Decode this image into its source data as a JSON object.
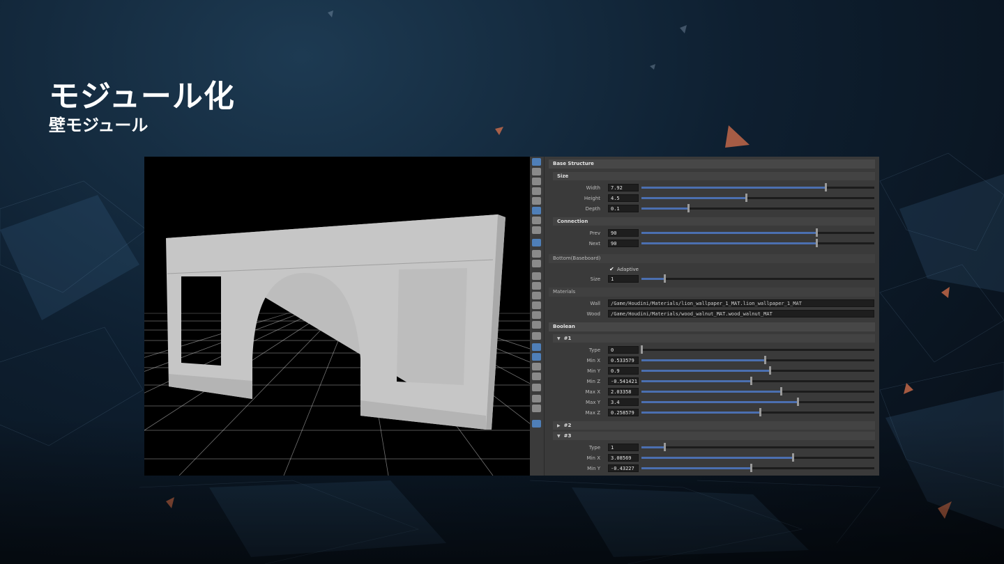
{
  "slide": {
    "title": "モジュール化",
    "subtitle": "壁モジュール"
  },
  "colors": {
    "slider_fill": "#4b6fb0",
    "panel_bg": "#3a3a3a",
    "field_bg": "#1e1e1e",
    "accent_triangle": "#e0744c"
  },
  "panel": {
    "base_structure": "Base Structure",
    "size": {
      "header": "Size",
      "width": {
        "label": "Width",
        "value": "7.92",
        "frac": 0.79
      },
      "height": {
        "label": "Height",
        "value": "4.5",
        "frac": 0.45
      },
      "depth": {
        "label": "Depth",
        "value": "0.1",
        "frac": 0.2
      }
    },
    "connection": {
      "header": "Connection",
      "prev": {
        "label": "Prev",
        "value": "90",
        "frac": 0.75
      },
      "next": {
        "label": "Next",
        "value": "90",
        "frac": 0.75
      }
    },
    "bottom": {
      "header": "Bottom(Baseboard)",
      "adaptive": {
        "label": "Adaptive",
        "checked": true
      },
      "size": {
        "label": "Size",
        "value": "1",
        "frac": 0.1
      }
    },
    "materials": {
      "header": "Materials",
      "wall": {
        "label": "Wall",
        "value": "/Game/Houdini/Materials/lion_wallpaper_1_MAT.lion_wallpaper_1_MAT"
      },
      "wood": {
        "label": "Wood",
        "value": "/Game/Houdini/Materials/wood_walnut_MAT.wood_walnut_MAT"
      }
    },
    "boolean": {
      "header": "Boolean",
      "b1": {
        "header": "#1",
        "type": {
          "label": "Type",
          "value": "0",
          "frac": 0.0
        },
        "minx": {
          "label": "Min X",
          "value": "0.533579",
          "frac": 0.53
        },
        "miny": {
          "label": "Min Y",
          "value": "0.9",
          "frac": 0.55
        },
        "minz": {
          "label": "Min Z",
          "value": "-0.541421",
          "frac": 0.47
        },
        "maxx": {
          "label": "Max X",
          "value": "2.03358",
          "frac": 0.6
        },
        "maxy": {
          "label": "Max Y",
          "value": "3.4",
          "frac": 0.67
        },
        "maxz": {
          "label": "Max Z",
          "value": "0.258579",
          "frac": 0.51
        }
      },
      "b2": {
        "header": "#2"
      },
      "b3": {
        "header": "#3",
        "type": {
          "label": "Type",
          "value": "1",
          "frac": 0.1
        },
        "minx": {
          "label": "Min X",
          "value": "3.08569",
          "frac": 0.65
        },
        "miny": {
          "label": "Min Y",
          "value": "-0.43227",
          "frac": 0.47
        }
      }
    }
  }
}
